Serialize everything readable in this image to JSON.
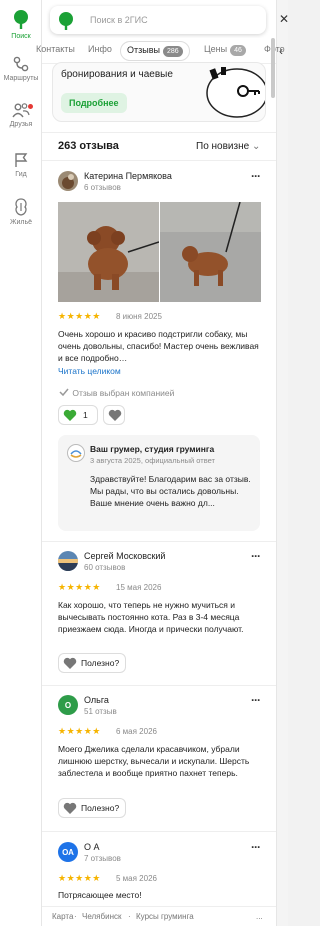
{
  "rail": {
    "items": [
      {
        "label": "Поиск",
        "icon": "logo-icon"
      },
      {
        "label": "Маршруты",
        "icon": "routes-icon"
      },
      {
        "label": "Друзья",
        "icon": "friends-icon"
      },
      {
        "label": "Гид",
        "icon": "flag-icon"
      },
      {
        "label": "Жильё",
        "icon": "housing-icon"
      }
    ]
  },
  "search": {
    "placeholder": "Поиск в 2ГИС"
  },
  "tabs": [
    {
      "label": "Контакты"
    },
    {
      "label": "Инфо"
    },
    {
      "label": "Отзывы",
      "count": "286"
    },
    {
      "label": "Цены",
      "count": "46"
    },
    {
      "label": "Фото"
    }
  ],
  "promo": {
    "text": "бронирования и чаевые",
    "button": "Подробнее"
  },
  "reviews_header": {
    "total": "263 отзыва",
    "sort": "По новизне"
  },
  "reviews": [
    {
      "author": "Катерина Пермякова",
      "count": "6 отзывов",
      "rating": "★★★★★",
      "date": "8 июня 2025",
      "text": "Очень хорошо и красиво подстригли собаку, мы очень довольны, спасибо! Мастер очень вежливая и все подробно…",
      "read_more": "Читать целиком",
      "company_note": "Отзыв выбран компанией",
      "likes": "1",
      "reply": {
        "author": "Ваш грумер, студия груминга",
        "meta": "3 августа 2025, официальный ответ",
        "text": "Здравствуйте! Благодарим вас за отзыв. Мы рады, что вы остались довольны. Ваше мнение очень важно дл..."
      }
    },
    {
      "author": "Сергей Московский",
      "count": "60 отзывов",
      "rating": "★★★★★",
      "date": "15 мая 2026",
      "text": "Как хорошо, что теперь не нужно мучиться и вычесывать постоянно кота. Раз в 3-4 месяца приезжаем сюда. Иногда и прически получают.",
      "useful": "Полезно?"
    },
    {
      "author": "Ольга",
      "initial": "О",
      "count": "51 отзыв",
      "rating": "★★★★★",
      "date": "6 мая 2026",
      "text": "Моего Джелика сделали красавчиком, убрали лишнюю шерстку, вычесали и искупали. Шерсть заблестела и вообще приятно пахнет теперь.",
      "useful": "Полезно?"
    },
    {
      "author": "О А",
      "initial": "ОА",
      "count": "7 отзывов",
      "rating": "★★★★★",
      "date": "5 мая 2026",
      "text": "Потрясающее место!"
    }
  ],
  "footer": {
    "items": [
      "Карта",
      "·",
      "Челябинск",
      "·",
      "Курсы груминга"
    ],
    "more": "..."
  },
  "colors": {
    "brand": "#1ba136",
    "link": "#1a73c9",
    "star": "#f6b400",
    "olga": "#2e9c49",
    "oa": "#1e73e8"
  }
}
